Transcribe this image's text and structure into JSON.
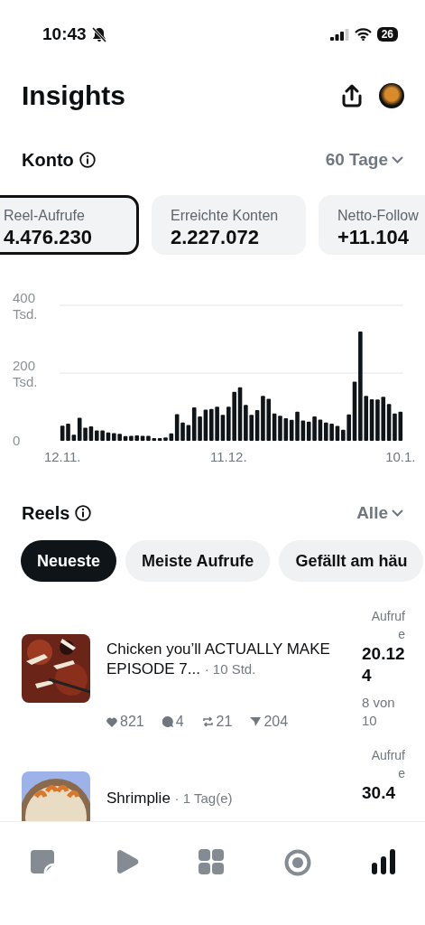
{
  "status_bar": {
    "time": "10:43",
    "muted": true,
    "battery": "26"
  },
  "header": {
    "title": "Insights"
  },
  "account": {
    "title": "Konto",
    "period": "60 Tage"
  },
  "metrics": [
    {
      "label": "Reel-Aufrufe",
      "value": "4.476.230",
      "selected": true
    },
    {
      "label": "Erreichte Konten",
      "value": "2.227.072",
      "selected": false
    },
    {
      "label": "Netto-Follow",
      "value": "+11.104",
      "selected": false
    }
  ],
  "chart_data": {
    "type": "bar",
    "ylim": [
      0,
      400
    ],
    "yticks": [
      {
        "value": 0,
        "label": "0"
      },
      {
        "value": 200,
        "label": "200 Tsd."
      },
      {
        "value": 400,
        "label": "400 Tsd."
      }
    ],
    "categories": [
      "12.11.",
      null,
      null,
      null,
      null,
      null,
      null,
      null,
      null,
      null,
      null,
      null,
      null,
      null,
      null,
      null,
      null,
      null,
      null,
      null,
      null,
      null,
      null,
      null,
      null,
      null,
      null,
      null,
      null,
      "11.12.",
      null,
      null,
      null,
      null,
      null,
      null,
      null,
      null,
      null,
      null,
      null,
      null,
      null,
      null,
      null,
      null,
      null,
      null,
      null,
      null,
      null,
      null,
      null,
      null,
      null,
      null,
      null,
      null,
      null,
      "10.1."
    ],
    "values": [
      45,
      51,
      18,
      68,
      39,
      43,
      31,
      31,
      25,
      23,
      21,
      14,
      15,
      16,
      15,
      15,
      8,
      8,
      10,
      22,
      79,
      54,
      47,
      99,
      72,
      92,
      94,
      101,
      77,
      101,
      145,
      158,
      106,
      77,
      91,
      133,
      124,
      81,
      74,
      67,
      62,
      86,
      60,
      57,
      72,
      63,
      54,
      51,
      44,
      33,
      78,
      175,
      323,
      133,
      123,
      122,
      130,
      109,
      81,
      86
    ]
  },
  "reels": {
    "title": "Reels",
    "filter": "Alle",
    "chips": [
      {
        "label": "Neueste",
        "selected": true
      },
      {
        "label": "Meiste Aufrufe",
        "selected": false
      },
      {
        "label": "Gefällt am häu",
        "selected": false
      }
    ],
    "items": [
      {
        "title": "Chicken you’ll ACTUALLY MAKE EPISODE 7...",
        "age": "· 10 Std.",
        "views_label": "Aufrufe",
        "views": "20.124",
        "rank": "8 von 10",
        "stats": [
          {
            "kind": "likes",
            "value": "821"
          },
          {
            "kind": "comments",
            "value": "4"
          },
          {
            "kind": "reposts",
            "value": "21"
          },
          {
            "kind": "shares",
            "value": "204"
          }
        ],
        "kind": "picture"
      },
      {
        "title": "Shrimplie",
        "age": "· 1 Tag(e)",
        "views_label": "Aufrufe",
        "views": "30.4",
        "kind": "picture"
      }
    ]
  },
  "tab_bar": [
    {
      "kind": "posts",
      "selected": false
    },
    {
      "kind": "reels",
      "selected": false
    },
    {
      "kind": "grid",
      "selected": false
    },
    {
      "kind": "live",
      "selected": false
    },
    {
      "kind": "insights",
      "selected": true
    }
  ]
}
